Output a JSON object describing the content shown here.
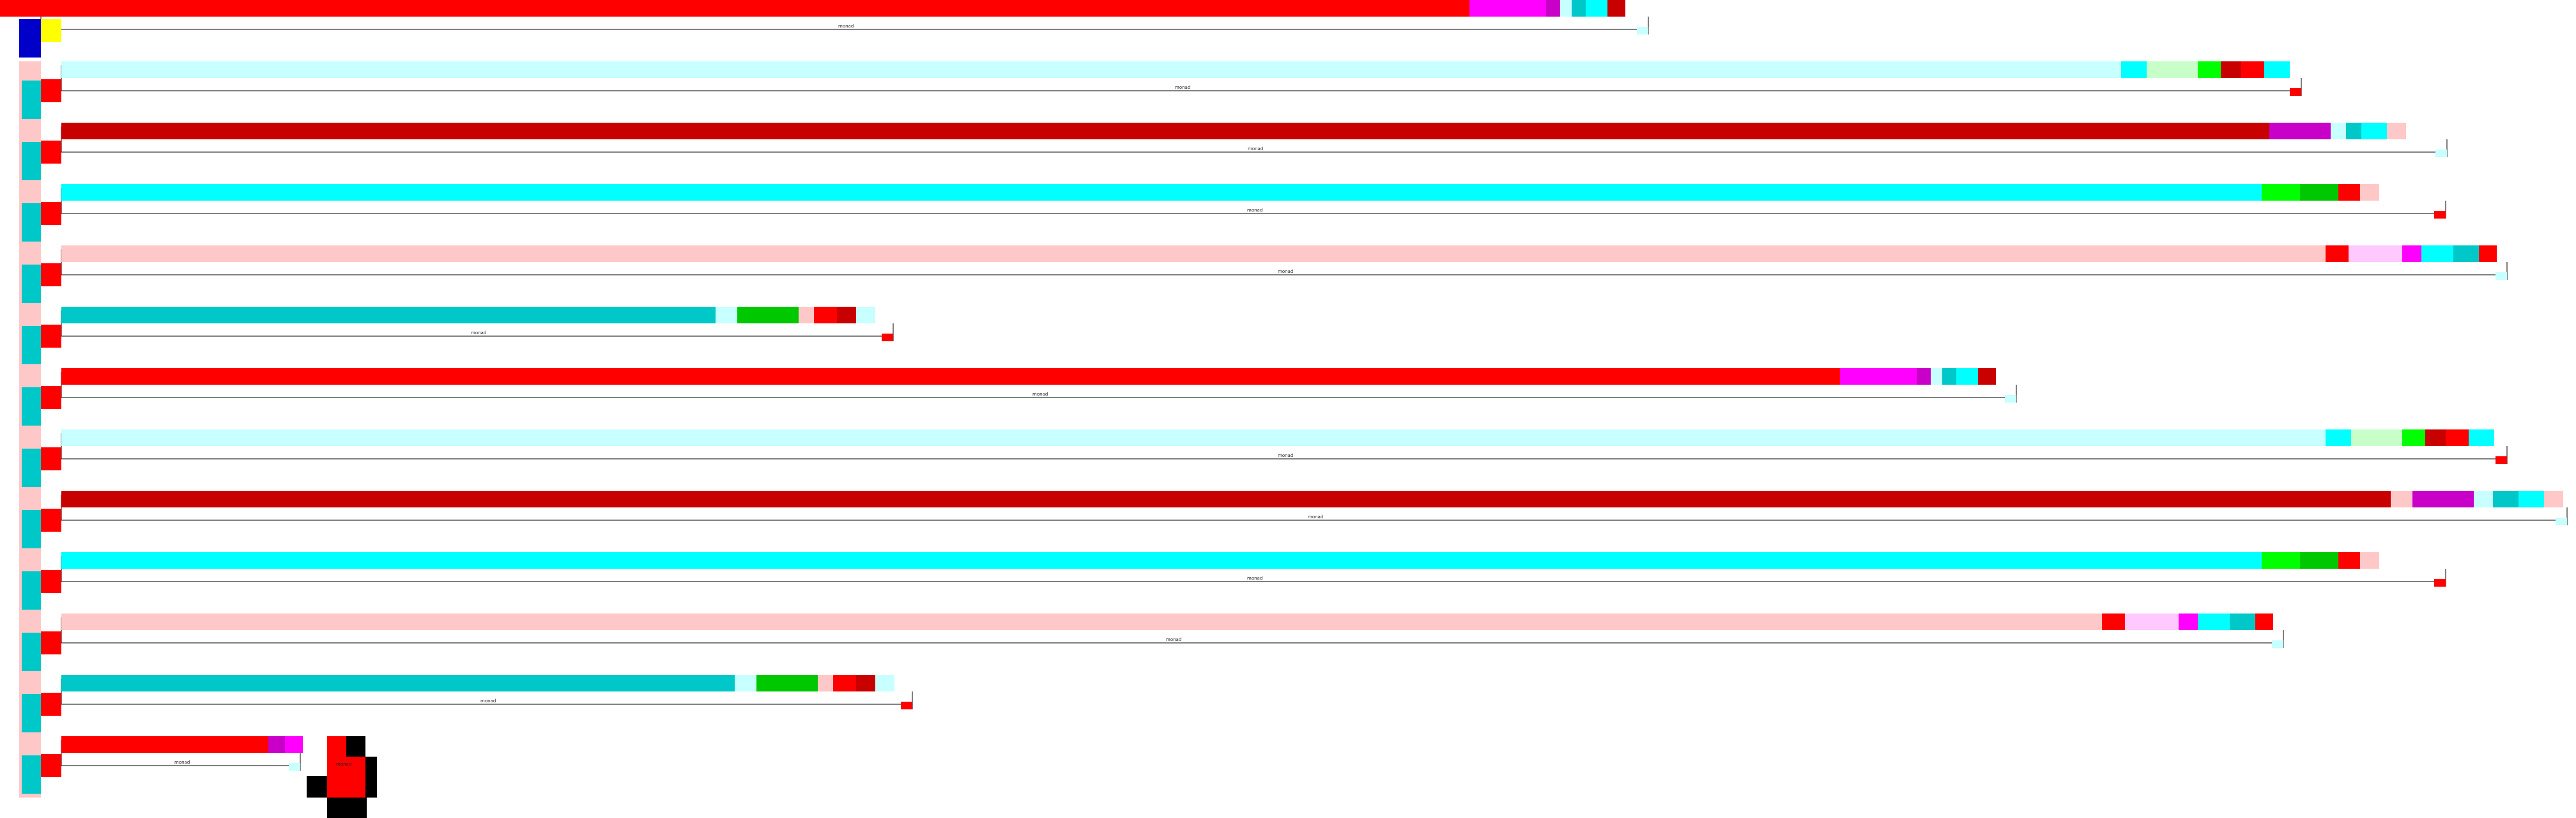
{
  "colors": {
    "red": "#ff0000",
    "dark_red": "#c80000",
    "magenta": "#ff00ff",
    "purple": "#c800c8",
    "light_magenta": "#ffc8ff",
    "cyan": "#00ffff",
    "teal": "#00c8c8",
    "light_cyan": "#c8ffff",
    "green": "#00ff00",
    "dark_green": "#00c800",
    "light_green": "#c8ffc8",
    "pink": "#ffc8c8",
    "yellow": "#ffff00",
    "blue": "#0000c8",
    "black": "#000000"
  },
  "wire_label": "monad",
  "bars": [
    {
      "bar": "red",
      "segs": [
        "magenta",
        "purple",
        "light_cyan",
        "teal",
        "cyan",
        "dark_red"
      ]
    },
    {
      "bar": "light_cyan",
      "segs": [
        "cyan",
        "light_green",
        "green",
        "dark_red",
        "red",
        "cyan"
      ]
    },
    {
      "bar": "dark_red",
      "segs": [
        "purple",
        "light_cyan",
        "teal",
        "cyan",
        "pink"
      ]
    },
    {
      "bar": "cyan",
      "segs": [
        "green",
        "dark_green",
        "red",
        "pink"
      ]
    },
    {
      "bar": "pink",
      "segs": [
        "red",
        "light_magenta",
        "magenta",
        "cyan",
        "teal",
        "red"
      ]
    },
    {
      "bar": "teal",
      "segs": [
        "light_cyan",
        "dark_green",
        "pink",
        "red",
        "dark_red",
        "light_cyan"
      ]
    },
    {
      "bar": "red",
      "segs": [
        "magenta",
        "purple",
        "light_cyan",
        "teal",
        "cyan",
        "dark_red"
      ]
    },
    {
      "bar": "light_cyan",
      "segs": [
        "cyan",
        "light_green",
        "green",
        "dark_red",
        "red",
        "cyan"
      ]
    },
    {
      "bar": "dark_red",
      "segs": [
        "pink",
        "purple",
        "light_cyan",
        "teal",
        "cyan",
        "pink"
      ]
    },
    {
      "bar": "cyan",
      "segs": [
        "green",
        "dark_green",
        "red",
        "pink"
      ]
    },
    {
      "bar": "pink",
      "segs": [
        "red",
        "light_magenta",
        "magenta",
        "cyan",
        "teal",
        "red"
      ]
    },
    {
      "bar": "teal",
      "segs": [
        "light_cyan",
        "dark_green",
        "pink",
        "red",
        "dark_red",
        "light_cyan"
      ]
    },
    {
      "bar": "red",
      "segs": [
        "purple",
        "magenta"
      ]
    }
  ]
}
